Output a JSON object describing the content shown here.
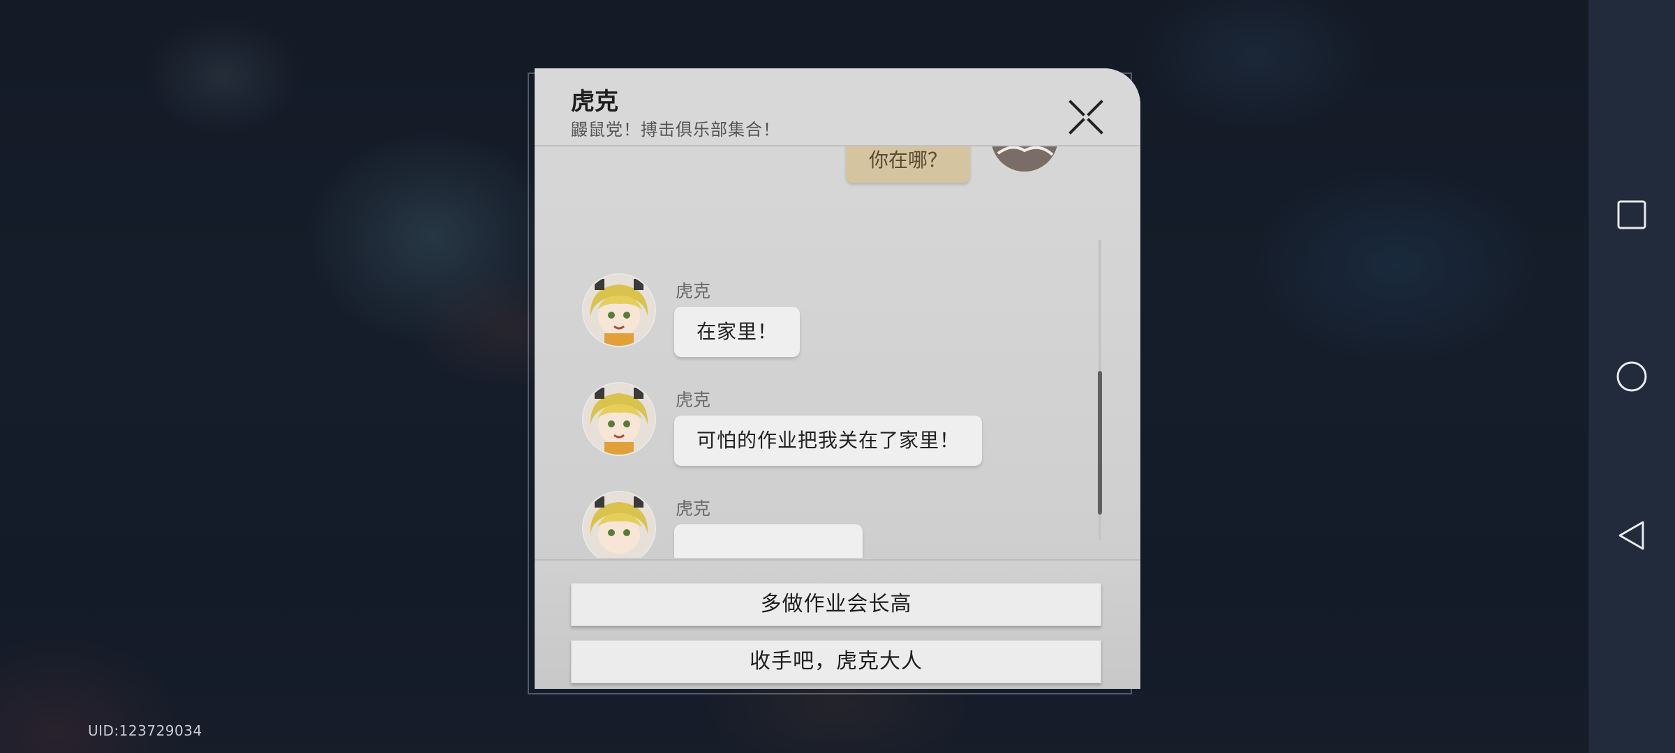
{
  "dialog": {
    "title": "虎克",
    "subtitle": "鼹鼠党！搏击俱乐部集合！"
  },
  "chat": {
    "self_message": "你在哪？",
    "messages": [
      {
        "sender": "虎克",
        "text": "在家里！"
      },
      {
        "sender": "虎克",
        "text": "可怕的作业把我关在了家里！"
      },
      {
        "sender": "虎克",
        "text": ""
      }
    ]
  },
  "options": [
    {
      "label": "多做作业会长高"
    },
    {
      "label": "收手吧，虎克大人"
    }
  ],
  "footer": {
    "uid": "UID:123729034"
  },
  "icons": {
    "close": "close-icon",
    "recent_apps": "square-icon",
    "home": "circle-icon",
    "back": "triangle-back-icon"
  },
  "colors": {
    "self_bubble": "#d4c4a0",
    "npc_bubble": "#efefef",
    "dialog_bg": "#d5d5d5"
  }
}
